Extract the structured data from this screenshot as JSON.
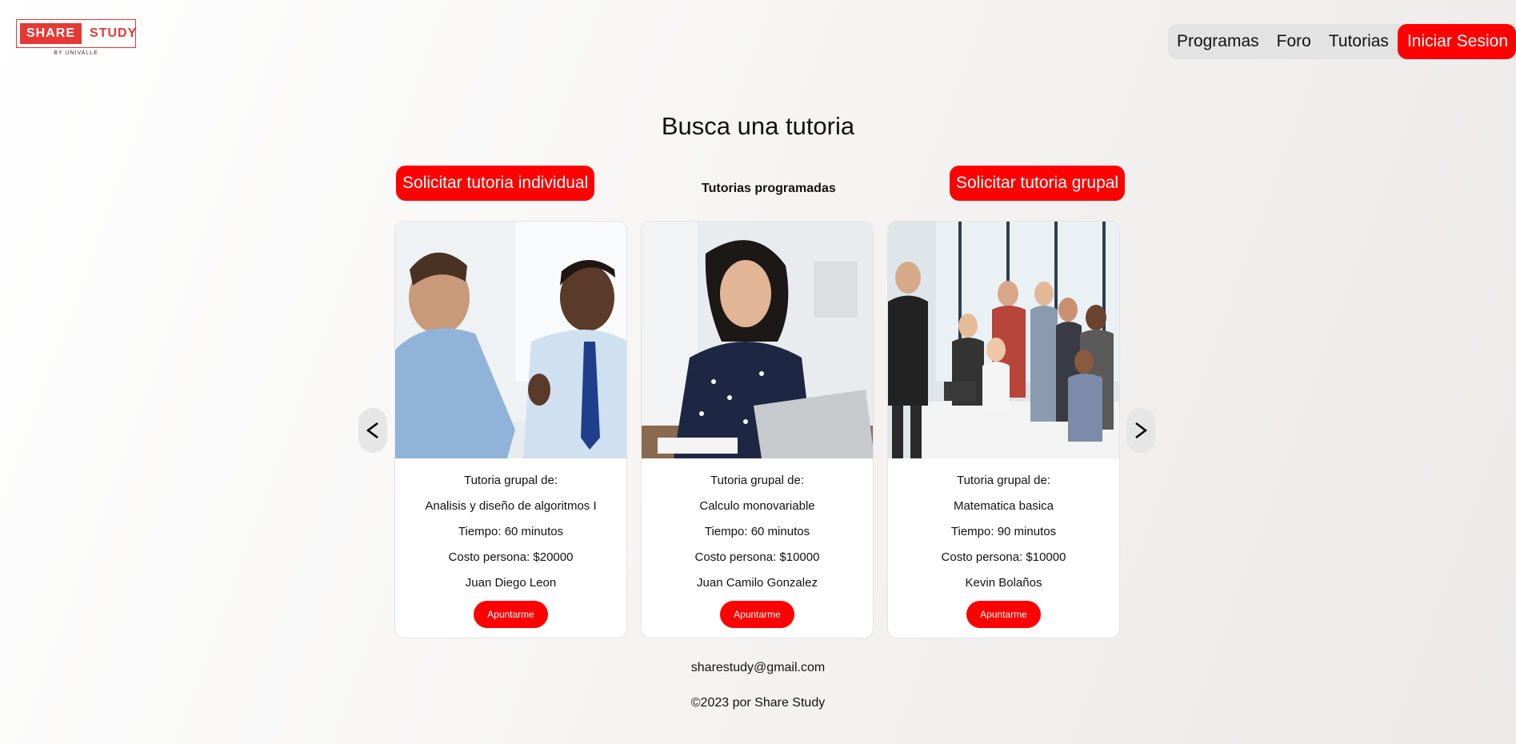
{
  "logo": {
    "share": "SHARE",
    "study": "STUDY",
    "sub": "BY UNIVALLE"
  },
  "nav": {
    "items": [
      "Programas",
      "Foro",
      "Tutorias"
    ],
    "login": "Iniciar Sesion"
  },
  "main": {
    "title": "Busca una tutoria",
    "individual_button": "Solicitar tutoria individual",
    "group_button": "Solicitar tutoria grupal",
    "programmed_title": "Tutorias programadas"
  },
  "cards": [
    {
      "heading": "Tutoria grupal de:",
      "subject": "Analisis y diseño de algoritmos I",
      "time": "Tiempo: 60 minutos",
      "cost": "Costo persona: $20000",
      "tutor": "Juan Diego Leon",
      "button": "Apuntarme",
      "image": "two-men-meeting-photo"
    },
    {
      "heading": "Tutoria grupal de:",
      "subject": "Calculo monovariable",
      "time": "Tiempo: 60 minutos",
      "cost": "Costo persona: $10000",
      "tutor": "Juan Camilo Gonzalez",
      "button": "Apuntarme",
      "image": "woman-laptop-photo"
    },
    {
      "heading": "Tutoria grupal de:",
      "subject": "Matematica basica",
      "time": "Tiempo: 90 minutos",
      "cost": "Costo persona: $10000",
      "tutor": "Kevin Bolaños",
      "button": "Apuntarme",
      "image": "group-meeting-photo"
    }
  ],
  "carousel": {
    "prev_icon": "chevron-left-icon",
    "next_icon": "chevron-right-icon"
  },
  "footer": {
    "email": "sharestudy@gmail.com",
    "copyright": "©2023 por Share Study"
  },
  "colors": {
    "accent": "#ff0000",
    "nav_bg": "#e3e3e3"
  }
}
